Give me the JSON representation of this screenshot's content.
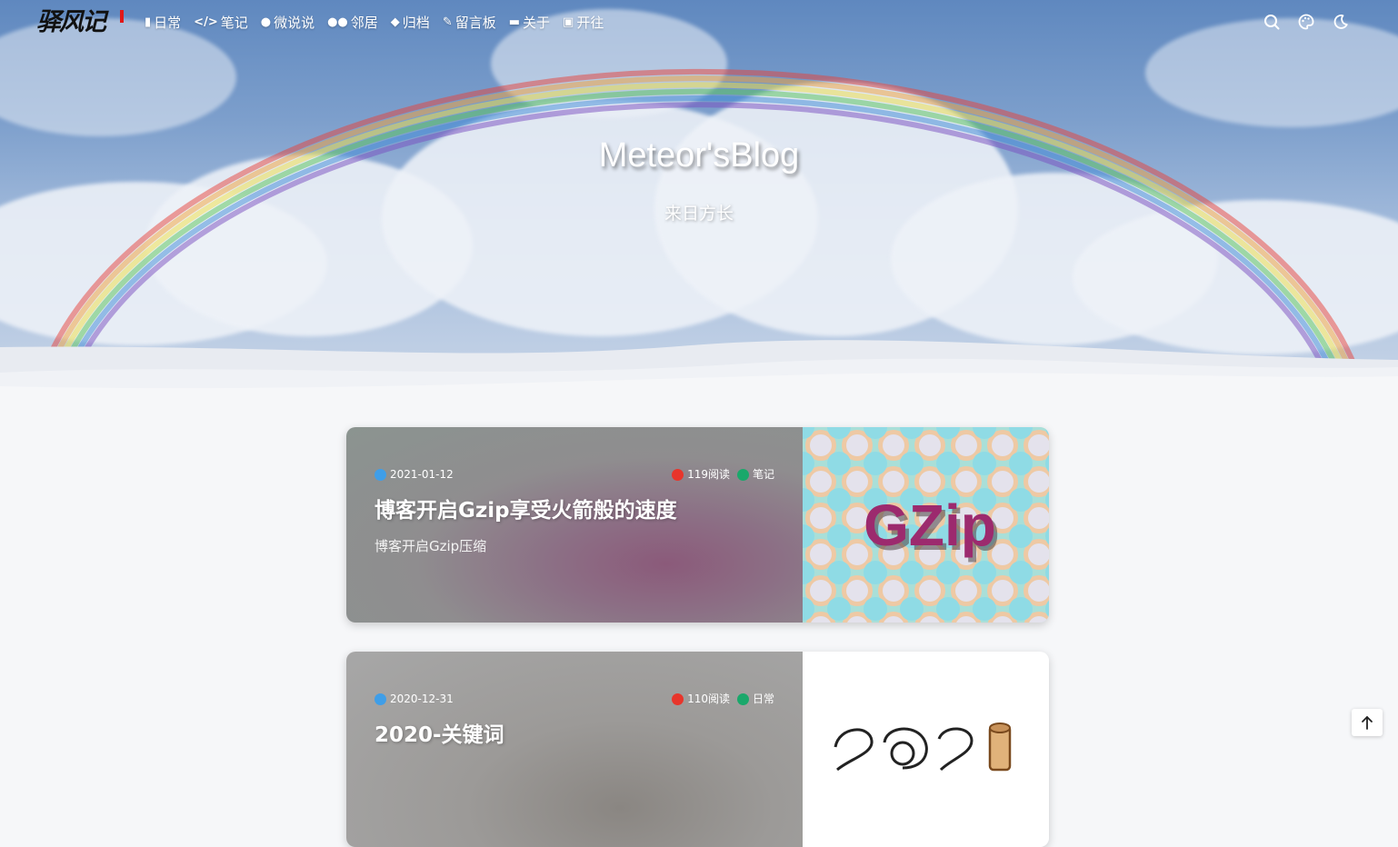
{
  "nav": {
    "logo_text": "驿风记",
    "items": [
      {
        "label": "日常",
        "icon": "book-icon"
      },
      {
        "label": "笔记",
        "icon": "code-icon"
      },
      {
        "label": "微说说",
        "icon": "comment-icon"
      },
      {
        "label": "邻居",
        "icon": "users-icon"
      },
      {
        "label": "归档",
        "icon": "tags-icon"
      },
      {
        "label": "留言板",
        "icon": "edit-icon"
      },
      {
        "label": "关于",
        "icon": "id-card-icon"
      },
      {
        "label": "开往",
        "icon": "subway-icon"
      }
    ],
    "tools": [
      "search-icon",
      "palette-icon",
      "moon-icon"
    ]
  },
  "hero": {
    "title": "Meteor'sBlog",
    "subtitle": "来日方长"
  },
  "posts": [
    {
      "date": "2021-01-12",
      "views": "119阅读",
      "tag": "笔记",
      "title": "博客开启Gzip享受火箭般的速度",
      "desc": "博客开启Gzip压缩",
      "cover_text": "GZip"
    },
    {
      "date": "2020-12-31",
      "views": "110阅读",
      "tag": "日常",
      "title": "2020-关键词",
      "desc": "",
      "cover_text": ""
    }
  ],
  "colors": {
    "calendar_badge": "#3f9ee8",
    "fire_badge": "#e8352b",
    "tag_badge": "#1aa86b",
    "gzip_text": "#9c2a6e"
  }
}
